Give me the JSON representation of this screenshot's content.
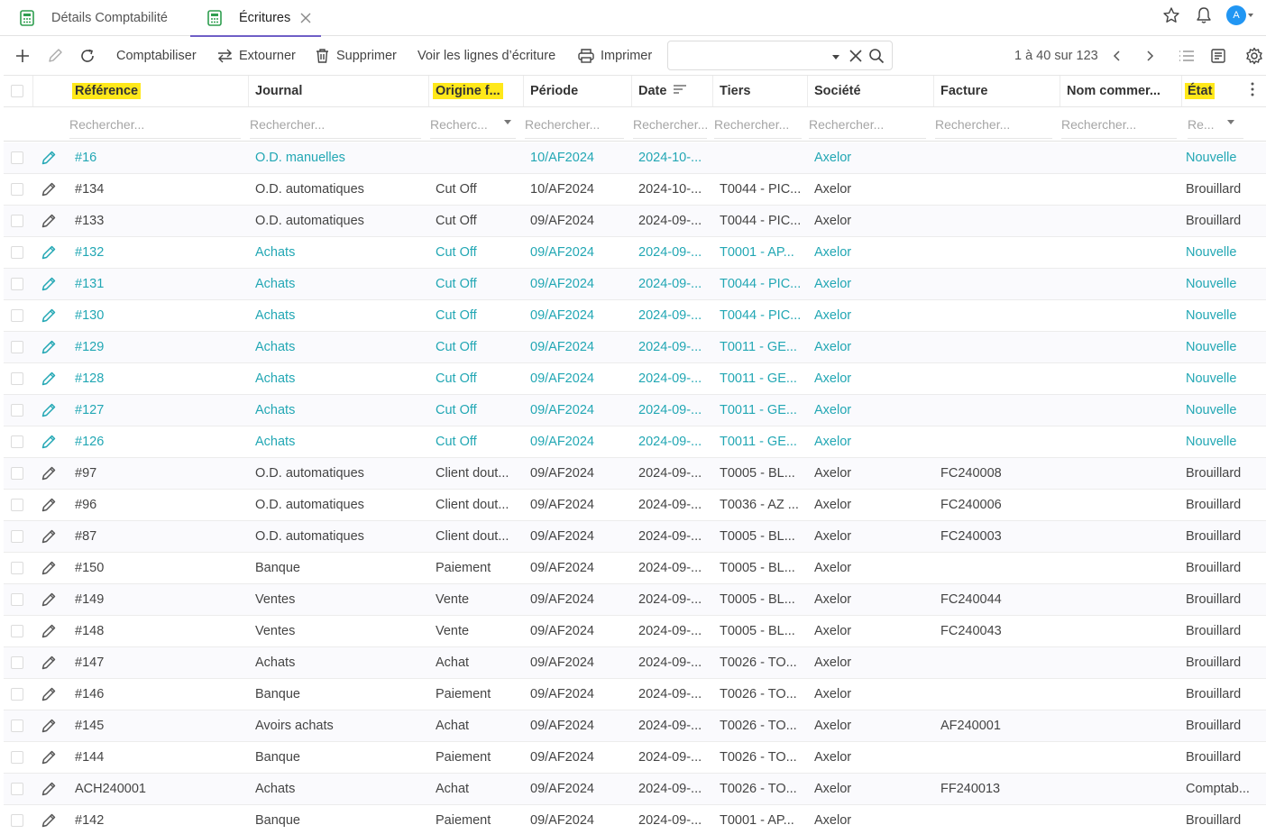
{
  "tabs": [
    {
      "label": "Détails Comptabilité"
    },
    {
      "label": "Écritures"
    }
  ],
  "toolbar": {
    "post_label": "Comptabiliser",
    "reverse_label": "Extourner",
    "delete_label": "Supprimer",
    "lines_label": "Voir les lignes d’écriture",
    "print_label": "Imprimer",
    "search_value": "",
    "pager": "1 à 40 sur 123"
  },
  "avatar_initial": "A",
  "colors": {
    "accent": "#6f5fc7",
    "teal": "#22a7b4",
    "highlight": "#ffe81a",
    "avatar": "#2196f3"
  },
  "columns": [
    {
      "label": "Référence",
      "highlight": true
    },
    {
      "label": "Journal",
      "highlight": false
    },
    {
      "label": "Origine f...",
      "highlight": true
    },
    {
      "label": "Période",
      "highlight": false
    },
    {
      "label": "Date",
      "highlight": false
    },
    {
      "label": "Tiers",
      "highlight": false
    },
    {
      "label": "Société",
      "highlight": false
    },
    {
      "label": "Facture",
      "highlight": false
    },
    {
      "label": "Nom commer...",
      "highlight": false
    },
    {
      "label": "État",
      "highlight": true
    }
  ],
  "filters": {
    "ref": "Rechercher...",
    "journal": "Rechercher...",
    "origin": "Recherc...",
    "period": "Rechercher...",
    "date": "Rechercher...",
    "tiers": "Rechercher...",
    "company": "Rechercher...",
    "invoice": "Rechercher...",
    "trade": "Rechercher...",
    "state": "Re..."
  },
  "rows": [
    {
      "ref": "#16",
      "journal": "O.D. manuelles",
      "origin": "",
      "period": "10/AF2024",
      "date": "2024-10-...",
      "tiers": "",
      "company": "Axelor",
      "invoice": "",
      "trade": "",
      "state": "Nouvelle",
      "teal": true
    },
    {
      "ref": "#134",
      "journal": "O.D. automatiques",
      "origin": "Cut Off",
      "period": "10/AF2024",
      "date": "2024-10-...",
      "tiers": "T0044 - PIC...",
      "company": "Axelor",
      "invoice": "",
      "trade": "",
      "state": "Brouillard",
      "teal": false
    },
    {
      "ref": "#133",
      "journal": "O.D. automatiques",
      "origin": "Cut Off",
      "period": "09/AF2024",
      "date": "2024-09-...",
      "tiers": "T0044 - PIC...",
      "company": "Axelor",
      "invoice": "",
      "trade": "",
      "state": "Brouillard",
      "teal": false
    },
    {
      "ref": "#132",
      "journal": "Achats",
      "origin": "Cut Off",
      "period": "09/AF2024",
      "date": "2024-09-...",
      "tiers": "T0001 - AP...",
      "company": "Axelor",
      "invoice": "",
      "trade": "",
      "state": "Nouvelle",
      "teal": true
    },
    {
      "ref": "#131",
      "journal": "Achats",
      "origin": "Cut Off",
      "period": "09/AF2024",
      "date": "2024-09-...",
      "tiers": "T0044 - PIC...",
      "company": "Axelor",
      "invoice": "",
      "trade": "",
      "state": "Nouvelle",
      "teal": true
    },
    {
      "ref": "#130",
      "journal": "Achats",
      "origin": "Cut Off",
      "period": "09/AF2024",
      "date": "2024-09-...",
      "tiers": "T0044 - PIC...",
      "company": "Axelor",
      "invoice": "",
      "trade": "",
      "state": "Nouvelle",
      "teal": true
    },
    {
      "ref": "#129",
      "journal": "Achats",
      "origin": "Cut Off",
      "period": "09/AF2024",
      "date": "2024-09-...",
      "tiers": "T0011 - GE...",
      "company": "Axelor",
      "invoice": "",
      "trade": "",
      "state": "Nouvelle",
      "teal": true
    },
    {
      "ref": "#128",
      "journal": "Achats",
      "origin": "Cut Off",
      "period": "09/AF2024",
      "date": "2024-09-...",
      "tiers": "T0011 - GE...",
      "company": "Axelor",
      "invoice": "",
      "trade": "",
      "state": "Nouvelle",
      "teal": true
    },
    {
      "ref": "#127",
      "journal": "Achats",
      "origin": "Cut Off",
      "period": "09/AF2024",
      "date": "2024-09-...",
      "tiers": "T0011 - GE...",
      "company": "Axelor",
      "invoice": "",
      "trade": "",
      "state": "Nouvelle",
      "teal": true
    },
    {
      "ref": "#126",
      "journal": "Achats",
      "origin": "Cut Off",
      "period": "09/AF2024",
      "date": "2024-09-...",
      "tiers": "T0011 - GE...",
      "company": "Axelor",
      "invoice": "",
      "trade": "",
      "state": "Nouvelle",
      "teal": true
    },
    {
      "ref": "#97",
      "journal": "O.D. automatiques",
      "origin": "Client dout...",
      "period": "09/AF2024",
      "date": "2024-09-...",
      "tiers": "T0005 - BL...",
      "company": "Axelor",
      "invoice": "FC240008",
      "trade": "",
      "state": "Brouillard",
      "teal": false
    },
    {
      "ref": "#96",
      "journal": "O.D. automatiques",
      "origin": "Client dout...",
      "period": "09/AF2024",
      "date": "2024-09-...",
      "tiers": "T0036 - AZ ...",
      "company": "Axelor",
      "invoice": "FC240006",
      "trade": "",
      "state": "Brouillard",
      "teal": false
    },
    {
      "ref": "#87",
      "journal": "O.D. automatiques",
      "origin": "Client dout...",
      "period": "09/AF2024",
      "date": "2024-09-...",
      "tiers": "T0005 - BL...",
      "company": "Axelor",
      "invoice": "FC240003",
      "trade": "",
      "state": "Brouillard",
      "teal": false
    },
    {
      "ref": "#150",
      "journal": "Banque",
      "origin": "Paiement",
      "period": "09/AF2024",
      "date": "2024-09-...",
      "tiers": "T0005 - BL...",
      "company": "Axelor",
      "invoice": "",
      "trade": "",
      "state": "Brouillard",
      "teal": false
    },
    {
      "ref": "#149",
      "journal": "Ventes",
      "origin": "Vente",
      "period": "09/AF2024",
      "date": "2024-09-...",
      "tiers": "T0005 - BL...",
      "company": "Axelor",
      "invoice": "FC240044",
      "trade": "",
      "state": "Brouillard",
      "teal": false
    },
    {
      "ref": "#148",
      "journal": "Ventes",
      "origin": "Vente",
      "period": "09/AF2024",
      "date": "2024-09-...",
      "tiers": "T0005 - BL...",
      "company": "Axelor",
      "invoice": "FC240043",
      "trade": "",
      "state": "Brouillard",
      "teal": false
    },
    {
      "ref": "#147",
      "journal": "Achats",
      "origin": "Achat",
      "period": "09/AF2024",
      "date": "2024-09-...",
      "tiers": "T0026 - TO...",
      "company": "Axelor",
      "invoice": "",
      "trade": "",
      "state": "Brouillard",
      "teal": false
    },
    {
      "ref": "#146",
      "journal": "Banque",
      "origin": "Paiement",
      "period": "09/AF2024",
      "date": "2024-09-...",
      "tiers": "T0026 - TO...",
      "company": "Axelor",
      "invoice": "",
      "trade": "",
      "state": "Brouillard",
      "teal": false
    },
    {
      "ref": "#145",
      "journal": "Avoirs achats",
      "origin": "Achat",
      "period": "09/AF2024",
      "date": "2024-09-...",
      "tiers": "T0026 - TO...",
      "company": "Axelor",
      "invoice": "AF240001",
      "trade": "",
      "state": "Brouillard",
      "teal": false
    },
    {
      "ref": "#144",
      "journal": "Banque",
      "origin": "Paiement",
      "period": "09/AF2024",
      "date": "2024-09-...",
      "tiers": "T0026 - TO...",
      "company": "Axelor",
      "invoice": "",
      "trade": "",
      "state": "Brouillard",
      "teal": false
    },
    {
      "ref": "ACH240001",
      "journal": "Achats",
      "origin": "Achat",
      "period": "09/AF2024",
      "date": "2024-09-...",
      "tiers": "T0026 - TO...",
      "company": "Axelor",
      "invoice": "FF240013",
      "trade": "",
      "state": "Comptab...",
      "teal": false
    },
    {
      "ref": "#142",
      "journal": "Banque",
      "origin": "Paiement",
      "period": "09/AF2024",
      "date": "2024-09-...",
      "tiers": "T0001 - AP...",
      "company": "Axelor",
      "invoice": "",
      "trade": "",
      "state": "Brouillard",
      "teal": false
    }
  ]
}
